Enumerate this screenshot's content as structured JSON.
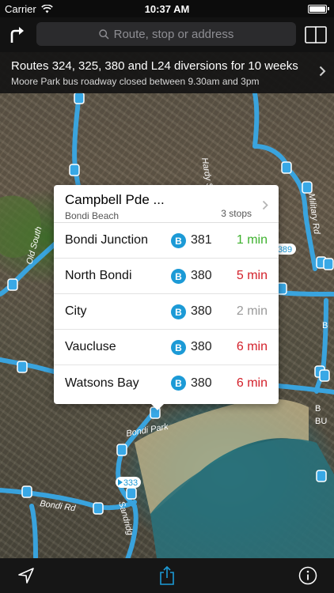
{
  "status_bar": {
    "carrier": "Carrier",
    "time": "10:37 AM",
    "battery_level": 1.0
  },
  "search": {
    "placeholder": "Route, stop or address"
  },
  "alert": {
    "title": "Routes 324, 325, 380 and L24 diversions for 10 weeks",
    "subtitle": "Moore Park bus roadway closed between 9.30am and 3pm"
  },
  "stop_card": {
    "name": "Campbell Pde ...",
    "suburb": "Bondi Beach",
    "stop_count": "3 stops",
    "departures": [
      {
        "destination": "Bondi Junction",
        "badge": "B",
        "route": "381",
        "eta": "1 min",
        "eta_color": "#3db12d"
      },
      {
        "destination": "North Bondi",
        "badge": "B",
        "route": "380",
        "eta": "5 min",
        "eta_color": "#d3202a"
      },
      {
        "destination": "City",
        "badge": "B",
        "route": "380",
        "eta": "2 min",
        "eta_color": "#9a9a9a"
      },
      {
        "destination": "Vaucluse",
        "badge": "B",
        "route": "380",
        "eta": "6 min",
        "eta_color": "#d3202a"
      },
      {
        "destination": "Watsons Bay",
        "badge": "B",
        "route": "380",
        "eta": "6 min",
        "eta_color": "#d3202a"
      }
    ]
  },
  "map_labels": {
    "hardy_st": "Hardy St",
    "bondi_rd": "Bondi Rd",
    "sandridge": "Sandridg",
    "bondi_park": "Bondi Park",
    "military_rd": "Military Rd",
    "old_south": "Old South",
    "route_389": "389",
    "route_333": "333",
    "b_label": "B",
    "bu_label": "BU",
    "bottom_b": "B"
  },
  "colors": {
    "route_line": "#38a8e6",
    "accent": "#1c9ad6"
  },
  "icons": {
    "directions": "turn-right-arrow-icon",
    "search": "magnifier-icon",
    "bookmarks": "book-icon",
    "location": "location-arrow-icon",
    "share": "share-icon",
    "info": "info-icon"
  }
}
